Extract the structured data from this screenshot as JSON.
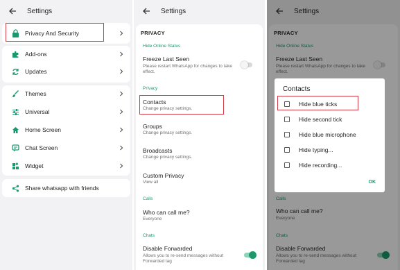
{
  "colors": {
    "accent": "#1a9a6c",
    "highlight": "#d23b45",
    "background": "#f2f2f4",
    "card": "#ffffff"
  },
  "screen1": {
    "title": "Settings",
    "card1": [
      {
        "label": "Privacy And Security",
        "icon": "lock-icon"
      }
    ],
    "card2": [
      {
        "label": "Add-ons",
        "icon": "puzzle-icon"
      },
      {
        "label": "Updates",
        "icon": "refresh-icon"
      }
    ],
    "card3": [
      {
        "label": "Themes",
        "icon": "brush-icon"
      },
      {
        "label": "Universal",
        "icon": "sliders-icon"
      },
      {
        "label": "Home Screen",
        "icon": "home-icon"
      },
      {
        "label": "Chat Screen",
        "icon": "chat-icon"
      },
      {
        "label": "Widget",
        "icon": "widget-icon"
      }
    ],
    "card4": [
      {
        "label": "Share whatsapp with friends",
        "icon": "share-icon"
      }
    ]
  },
  "screen2": {
    "title": "Settings",
    "section_header": "PRIVACY",
    "hide_online_status": "Hide Online Status",
    "freeze_title": "Freeze Last Seen",
    "freeze_sub": "Please restart WhatsApp for changes to take effect.",
    "freeze_enabled": false,
    "privacy_section": "Privacy",
    "contacts_title": "Contacts",
    "contacts_sub": "Change privacy settings.",
    "groups_title": "Groups",
    "groups_sub": "Change privacy settings.",
    "broadcasts_title": "Broadcasts",
    "broadcasts_sub": "Change privacy settings.",
    "custom_title": "Custom Privacy",
    "custom_sub": "View all",
    "calls_section": "Calls",
    "calls_title": "Who can call me?",
    "calls_sub": "Everyone",
    "chats_section": "Chats",
    "forward_title": "Disable Forwarded",
    "forward_sub": "Allows you to re-send messages without Forwarded tag",
    "forward_enabled": true
  },
  "screen3": {
    "title": "Settings",
    "section_header": "PRIVACY",
    "hide_online_status": "Hide Online Status",
    "freeze_title": "Freeze Last Seen",
    "freeze_sub": "Please restart WhatsApp for changes to take effect.",
    "calls_section": "Calls",
    "calls_title": "Who can call me?",
    "calls_sub": "Everyone",
    "chats_section": "Chats",
    "forward_title": "Disable Forwarded",
    "forward_sub": "Allows you to re-send messages without Forwarded tag",
    "dialog": {
      "title": "Contacts",
      "options": [
        {
          "label": "Hide blue ticks",
          "checked": false
        },
        {
          "label": "Hide second tick",
          "checked": false
        },
        {
          "label": "Hide blue microphone",
          "checked": false
        },
        {
          "label": "Hide typing...",
          "checked": false
        },
        {
          "label": "Hide recording...",
          "checked": false
        }
      ],
      "ok_label": "OK"
    }
  }
}
